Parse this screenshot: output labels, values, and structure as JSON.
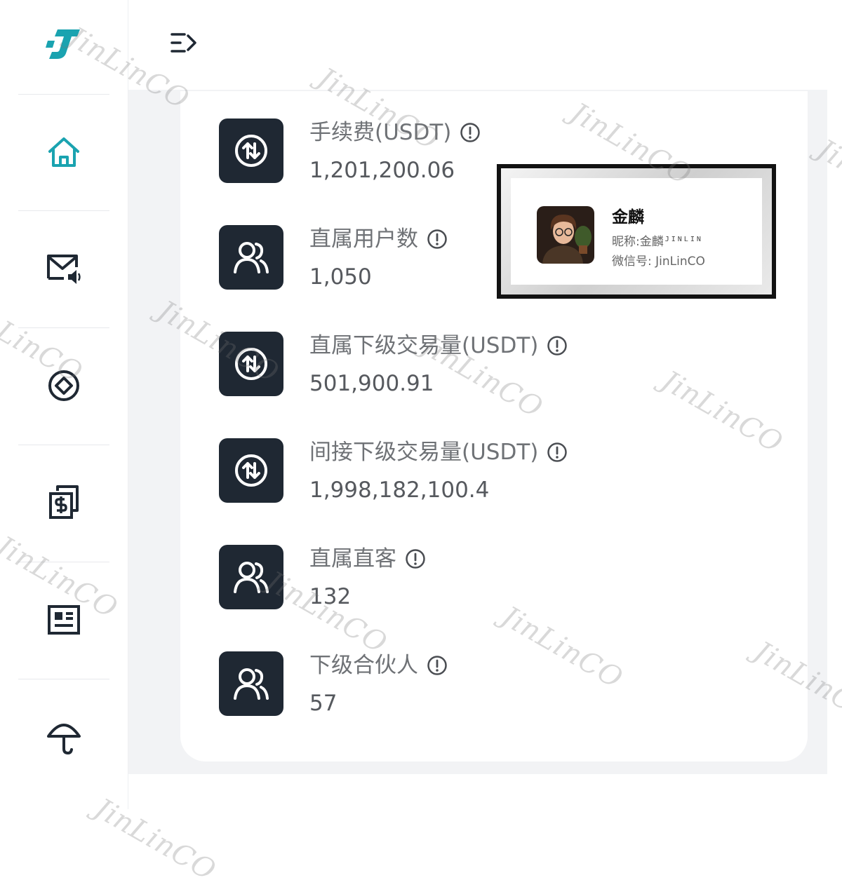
{
  "app": {
    "logo_letter": "J",
    "accent": "#1aa3b0"
  },
  "sidebar": {
    "items": [
      {
        "name": "home",
        "icon": "home-icon"
      },
      {
        "name": "messages",
        "icon": "mail-speaker-icon"
      },
      {
        "name": "compass",
        "icon": "diamond-circle-icon"
      },
      {
        "name": "finance",
        "icon": "dollar-documents-icon"
      },
      {
        "name": "news",
        "icon": "newspaper-icon"
      },
      {
        "name": "insurance",
        "icon": "umbrella-icon"
      }
    ]
  },
  "topbar": {
    "menu_icon": "menu-expand-icon"
  },
  "stats": [
    {
      "label": "手续费(USDT)",
      "value": "1,201,200.06",
      "icon": "swap-circle-icon"
    },
    {
      "label": "直属用户数",
      "value": "1,050",
      "icon": "users-icon"
    },
    {
      "label": "直属下级交易量(USDT)",
      "value": "501,900.91",
      "icon": "swap-circle-icon"
    },
    {
      "label": "间接下级交易量(USDT)",
      "value": "1,998,182,100.4",
      "icon": "swap-circle-icon"
    },
    {
      "label": "直属直客",
      "value": "132",
      "icon": "users-icon"
    },
    {
      "label": "下级合伙人",
      "value": "57",
      "icon": "users-icon"
    }
  ],
  "profile": {
    "name": "金麟",
    "nickname": "昵称:金麟",
    "mark": "JINLIN",
    "wechat": "微信号: JinLinCO"
  },
  "watermark": "JinLinCO"
}
